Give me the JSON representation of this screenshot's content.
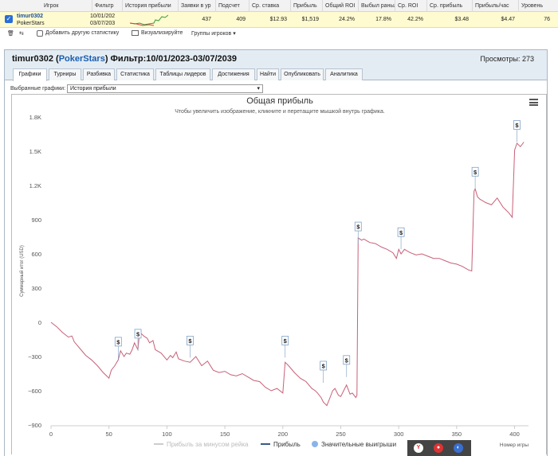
{
  "table": {
    "headers": [
      "Игрок",
      "Фильтр",
      "История прибыли",
      "Заявки в ур",
      "Подсчет",
      "Ср. ставка",
      "Прибыль",
      "Общий ROI",
      "Выбыл раньше",
      "Ср. ROI",
      "Ср. прибыль",
      "Прибыль/час",
      "Уровень"
    ],
    "row": {
      "player": "timur0302",
      "site": "PokerStars",
      "filter_from": "10/01/202",
      "filter_to": "03/07/203",
      "entries": "437",
      "count": "409",
      "avg_stake": "$12.93",
      "profit": "$1,519",
      "total_roi": "24.2%",
      "early": "17.8%",
      "avg_roi": "42.2%",
      "avg_profit": "$3.48",
      "profit_hour": "$4.47",
      "level": "76"
    }
  },
  "toolbar": {
    "add_stats": "Добавить другую статистику",
    "visualize": "Визуализируйте",
    "groups": "Группы игроков"
  },
  "panel": {
    "player": "timur0302",
    "site": "PokerStars",
    "filter": "Фильтр:10/01/2023-03/07/2039",
    "views": "Просмотры: 273"
  },
  "tabs": [
    "Графики",
    "Турниры",
    "Разбивка",
    "Статистика",
    "Таблицы лидеров",
    "Достижения",
    "Найти",
    "Опубликовать",
    "Аналитика"
  ],
  "selector": {
    "label": "Выбранные графики:",
    "value": "История прибыли"
  },
  "chart_data": {
    "type": "line",
    "title": "Общая прибыль",
    "subtitle": "Чтобы увеличить изображение, кликните и перетащите мышкой внутрь графика.",
    "ylabel": "Суммарный итог (USD)",
    "xlabel": "Номер игры",
    "xlim": [
      0,
      412
    ],
    "ylim": [
      -900,
      1800
    ],
    "xticks": [
      0,
      50,
      100,
      150,
      200,
      250,
      300,
      350,
      400
    ],
    "yticks": [
      -900,
      -600,
      -300,
      0,
      300,
      600,
      900,
      1200,
      1500,
      1800
    ],
    "ytick_labels": [
      "−900",
      "−600",
      "−300",
      "0",
      "300",
      "600",
      "900",
      "1.2K",
      "1.5K",
      "1.8K"
    ],
    "legend": [
      "Прибыль за минусом рейка",
      "Прибыль",
      "Значительные выигрыши"
    ],
    "series": [
      {
        "name": "Прибыль",
        "color": "#c86078",
        "x": [
          0,
          5,
          10,
          15,
          18,
          20,
          25,
          30,
          35,
          40,
          45,
          48,
          50,
          52,
          55,
          58,
          60,
          63,
          65,
          68,
          70,
          72,
          75,
          76,
          78,
          80,
          83,
          85,
          88,
          90,
          95,
          100,
          103,
          105,
          108,
          110,
          115,
          120,
          125,
          130,
          135,
          140,
          145,
          150,
          155,
          160,
          165,
          170,
          175,
          180,
          185,
          190,
          195,
          200,
          202,
          205,
          210,
          215,
          220,
          225,
          228,
          230,
          233,
          235,
          238,
          240,
          243,
          245,
          248,
          250,
          252,
          255,
          258,
          260,
          263,
          264,
          265,
          268,
          270,
          275,
          280,
          285,
          290,
          295,
          298,
          300,
          302,
          305,
          310,
          315,
          320,
          325,
          330,
          335,
          340,
          345,
          350,
          355,
          360,
          363,
          365,
          366,
          368,
          370,
          375,
          380,
          385,
          390,
          395,
          398,
          400,
          402,
          405,
          408
        ],
        "y": [
          0,
          -40,
          -90,
          -130,
          -120,
          -170,
          -230,
          -290,
          -330,
          -380,
          -440,
          -470,
          -490,
          -420,
          -380,
          -330,
          -250,
          -300,
          -270,
          -280,
          -240,
          -180,
          -240,
          -130,
          -100,
          -120,
          -140,
          -180,
          -160,
          -240,
          -270,
          -330,
          -290,
          -310,
          -260,
          -320,
          -340,
          -350,
          -300,
          -380,
          -340,
          -420,
          -440,
          -430,
          -460,
          -470,
          -450,
          -480,
          -510,
          -520,
          -570,
          -600,
          -580,
          -620,
          -350,
          -380,
          -440,
          -490,
          -520,
          -580,
          -600,
          -620,
          -660,
          -700,
          -730,
          -680,
          -600,
          -580,
          -640,
          -650,
          -610,
          -550,
          -630,
          -620,
          -660,
          -640,
          740,
          720,
          730,
          700,
          690,
          660,
          640,
          610,
          560,
          640,
          600,
          640,
          610,
          590,
          600,
          580,
          560,
          560,
          540,
          520,
          510,
          490,
          460,
          450,
          1150,
          1170,
          1100,
          1080,
          1050,
          1030,
          1090,
          1010,
          960,
          920,
          1510,
          1570,
          1540,
          1580
        ]
      }
    ],
    "big_wins": [
      {
        "x": 58,
        "y": -320
      },
      {
        "x": 75,
        "y": -250
      },
      {
        "x": 120,
        "y": -310
      },
      {
        "x": 202,
        "y": -310
      },
      {
        "x": 235,
        "y": -530
      },
      {
        "x": 255,
        "y": -480
      },
      {
        "x": 265,
        "y": 690
      },
      {
        "x": 302,
        "y": 640
      },
      {
        "x": 366,
        "y": 1170
      },
      {
        "x": 402,
        "y": 1580
      }
    ],
    "big_win_label": "$",
    "grid": false,
    "legend_position": "bottom"
  }
}
